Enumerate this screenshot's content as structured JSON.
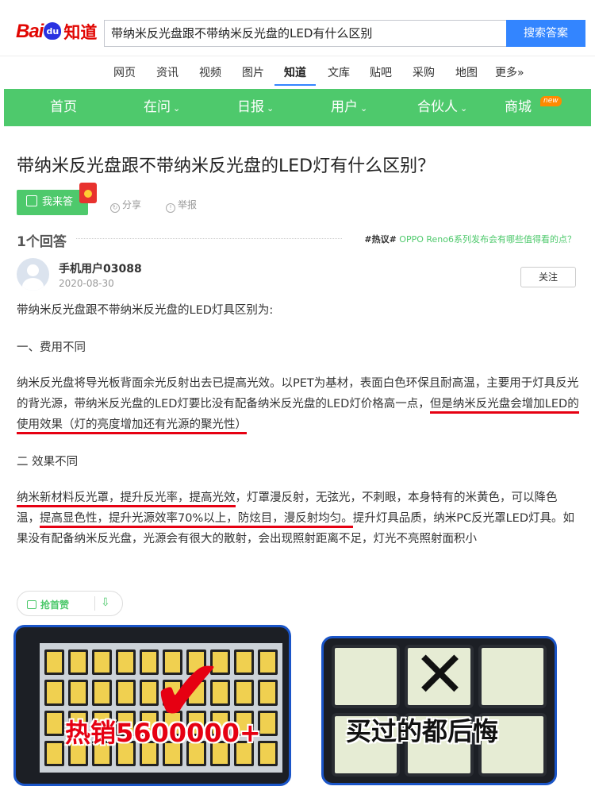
{
  "header": {
    "logo_bai": "Bai",
    "logo_du": "du",
    "logo_zhidao": "知道",
    "search_value": "带纳米反光盘跟不带纳米反光盘的LED有什么区别",
    "search_button": "搜索答案"
  },
  "channels": [
    "网页",
    "资讯",
    "视频",
    "图片",
    "知道",
    "文库",
    "贴吧",
    "采购",
    "地图",
    "更多»"
  ],
  "active_channel": "知道",
  "greennav": {
    "items": [
      "首页",
      "在问",
      "日报",
      "用户",
      "合伙人",
      "商城"
    ],
    "badge": "new"
  },
  "question": {
    "title": "带纳米反光盘跟不带纳米反光盘的LED灯有什么区别？",
    "answer_button": "我来答",
    "share": "分享",
    "report": "举报"
  },
  "answers": {
    "count_label": "1个回答",
    "hot_tag": "#热议#",
    "hot_text": "OPPO Reno6系列发布会有哪些值得看的点？"
  },
  "answer": {
    "username": "手机用户03088",
    "date": "2020-08-30",
    "follow": "关注",
    "intro": "带纳米反光盘跟不带纳米反光盘的LED灯具区别为:",
    "heading1": "一、费用不同",
    "p1_plain": "纳米反光盘将导光板背面余光反射出去已提高光效。以PET为基材，表面白色环保且耐高温，主要用于灯具反光的背光源，带纳米反光盘的LED灯要比没有配备纳米反光盘的LED灯价格高一点，",
    "p1_highlight": "但是纳米反光盘会增加LED的使用效果（灯的亮度增加还有光源的聚光性）",
    "heading2": "二 效果不同",
    "p2_highlight1": "纳米新材料反光罩，提升反光率，提高光效",
    "p2_plain1": "，灯罩漫反射，无弦光，不刺眼，本身特有的米黄色，可以降色温，",
    "p2_highlight2": "提高显色性，提升光源效率70%以上，防炫目，漫反射均匀。",
    "p2_plain2": "提升灯具品质，纳米PC反光罩LED灯具。如果没有配备纳米反光盘，光源会有很大的散射，会出现照射距离不足，灯光不亮照射面积小"
  },
  "like_bar": {
    "like": "抢首赞"
  },
  "ads": {
    "left_text": "热销5600000+",
    "right_text": "买过的都后悔",
    "accent": "#e60012",
    "border": "#1a55c8"
  }
}
